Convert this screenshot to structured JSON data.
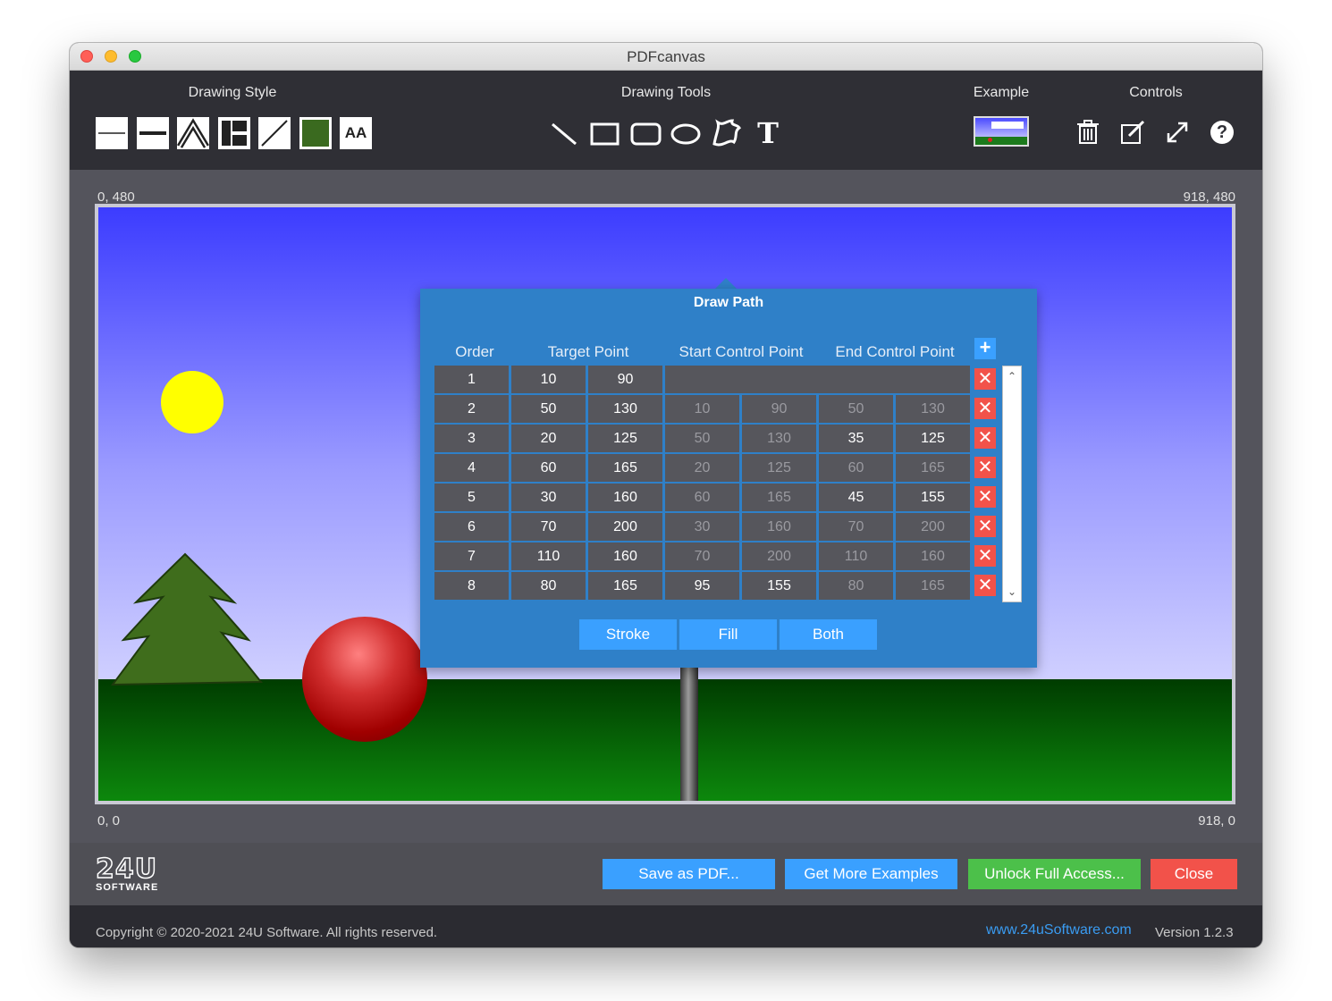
{
  "window": {
    "title": "PDFcanvas"
  },
  "toolbar": {
    "drawing_style_label": "Drawing Style",
    "drawing_tools_label": "Drawing Tools",
    "example_label": "Example",
    "controls_label": "Controls",
    "style_buttons": [
      "thin-line-style-icon",
      "thick-line-style-icon",
      "line-join-icon",
      "line-cap-icon",
      "stroke-color-icon",
      "fill-color-icon",
      "font-style-icon"
    ],
    "fill_color": "#3a6a1f",
    "font_button_text": "AA",
    "tools": [
      "line-tool-icon",
      "rectangle-tool-icon",
      "rounded-rectangle-tool-icon",
      "oval-tool-icon",
      "path-tool-icon",
      "text-tool-icon"
    ],
    "text_tool_glyph": "T",
    "controls": [
      "trash-icon",
      "edit-icon",
      "fullscreen-icon",
      "help-icon"
    ],
    "help_glyph": "?"
  },
  "canvas": {
    "top_left": "0, 480",
    "top_right": "918, 480",
    "bottom_left": "0, 0",
    "bottom_right": "918, 0",
    "sun_color": "#ffff00",
    "tree_color": "#3f6d1c"
  },
  "draw_path": {
    "title": "Draw Path",
    "columns": {
      "order": "Order",
      "target": "Target Point",
      "start": "Start Control Point",
      "end": "End Control Point"
    },
    "add_glyph": "+",
    "delete_glyph": "✕",
    "rows": [
      {
        "order": "1",
        "tx": "10",
        "ty": "90",
        "sx": "",
        "sy": "",
        "ex": "",
        "ey": "",
        "start_active": false,
        "end_active": false
      },
      {
        "order": "2",
        "tx": "50",
        "ty": "130",
        "sx": "10",
        "sy": "90",
        "ex": "50",
        "ey": "130",
        "start_active": false,
        "end_active": false
      },
      {
        "order": "3",
        "tx": "20",
        "ty": "125",
        "sx": "50",
        "sy": "130",
        "ex": "35",
        "ey": "125",
        "start_active": false,
        "end_active": true
      },
      {
        "order": "4",
        "tx": "60",
        "ty": "165",
        "sx": "20",
        "sy": "125",
        "ex": "60",
        "ey": "165",
        "start_active": false,
        "end_active": false
      },
      {
        "order": "5",
        "tx": "30",
        "ty": "160",
        "sx": "60",
        "sy": "165",
        "ex": "45",
        "ey": "155",
        "start_active": false,
        "end_active": true
      },
      {
        "order": "6",
        "tx": "70",
        "ty": "200",
        "sx": "30",
        "sy": "160",
        "ex": "70",
        "ey": "200",
        "start_active": false,
        "end_active": false
      },
      {
        "order": "7",
        "tx": "110",
        "ty": "160",
        "sx": "70",
        "sy": "200",
        "ex": "110",
        "ey": "160",
        "start_active": false,
        "end_active": false
      },
      {
        "order": "8",
        "tx": "80",
        "ty": "165",
        "sx": "95",
        "sy": "155",
        "ex": "80",
        "ey": "165",
        "start_active": true,
        "end_active": false
      }
    ],
    "buttons": {
      "stroke": "Stroke",
      "fill": "Fill",
      "both": "Both"
    }
  },
  "bottom": {
    "logo_top": "24U",
    "logo_bottom": "SOFTWARE",
    "save_pdf": "Save as PDF...",
    "get_examples": "Get More Examples",
    "unlock": "Unlock Full Access...",
    "close": "Close",
    "colors": {
      "blue": "#3aa0ff",
      "green": "#4cc04a",
      "red": "#f2524a"
    }
  },
  "footer": {
    "copyright": "Copyright © 2020-2021 24U Software. All rights reserved.",
    "website": "www.24uSoftware.com",
    "version": "Version 1.2.3"
  }
}
